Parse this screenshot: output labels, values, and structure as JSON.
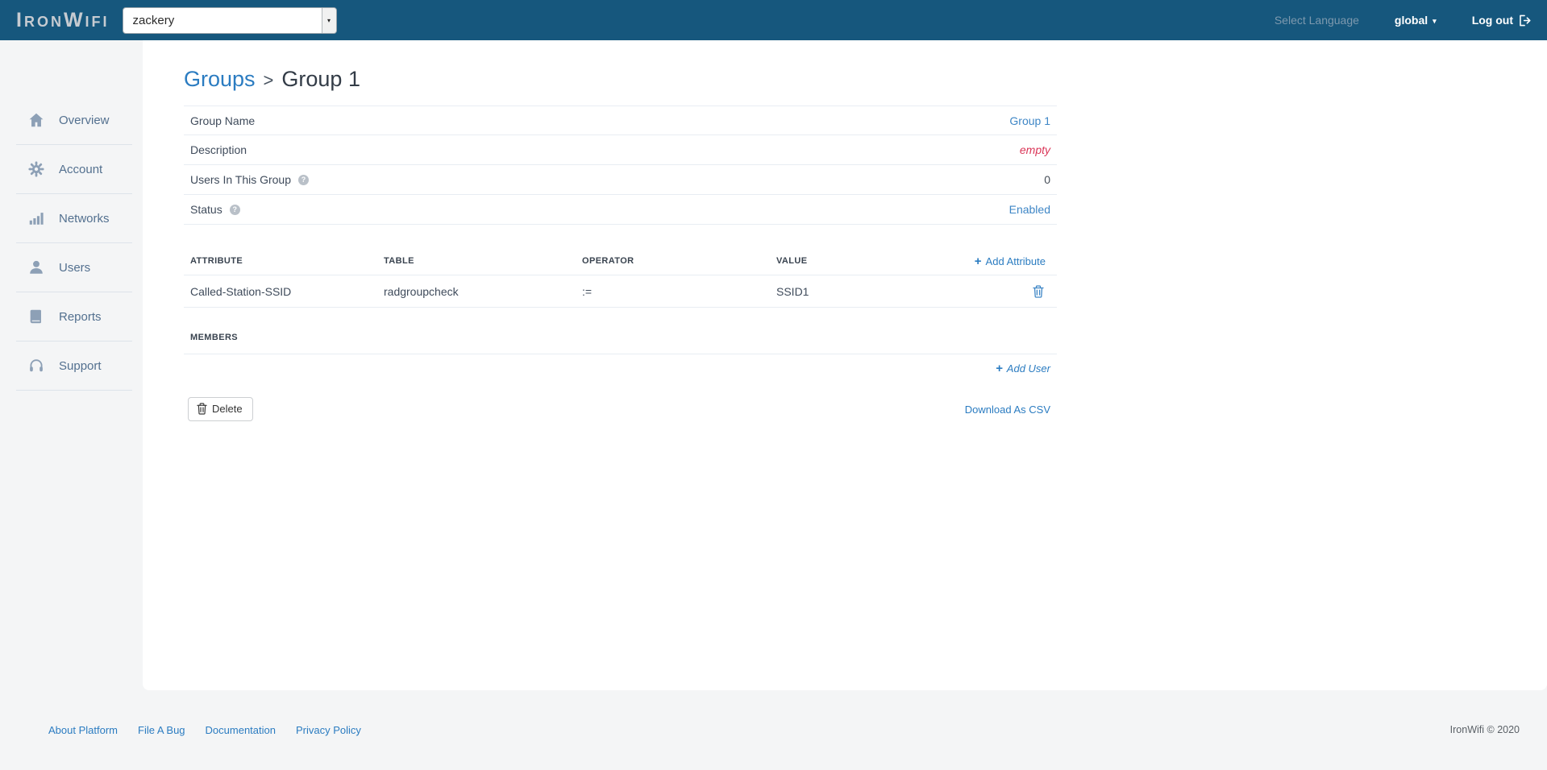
{
  "colors": {
    "navbar_bg": "#16577d",
    "accent_link": "#2b7cc1",
    "value_link": "#3e86c6",
    "empty_red": "#da3557",
    "page_bg": "#f4f5f6",
    "panel_bg": "#ffffff",
    "sidebar_icon": "#8da0b6"
  },
  "icons": {
    "plus": "+",
    "caret": "▾",
    "help": "?"
  },
  "navbar": {
    "logo": "IronWifi",
    "account_select": {
      "value": "zackery"
    },
    "select_language": "Select Language",
    "region": "global",
    "logout_label": "Log out"
  },
  "sidebar": {
    "items": [
      {
        "label": "Overview",
        "icon": "home-icon"
      },
      {
        "label": "Account",
        "icon": "gear-icon"
      },
      {
        "label": "Networks",
        "icon": "bar-chart-icon"
      },
      {
        "label": "Users",
        "icon": "user-icon"
      },
      {
        "label": "Reports",
        "icon": "book-icon"
      },
      {
        "label": "Support",
        "icon": "headset-icon"
      }
    ]
  },
  "breadcrumb": {
    "parent": "Groups",
    "separator": ">",
    "current": "Group 1"
  },
  "details": {
    "rows": [
      {
        "label": "Group Name",
        "value": "Group 1",
        "value_type": "link",
        "help": false
      },
      {
        "label": "Description",
        "value": "empty",
        "value_type": "empty",
        "help": false
      },
      {
        "label": "Users In This Group",
        "value": "0",
        "value_type": "plain",
        "help": true
      },
      {
        "label": "Status",
        "value": "Enabled",
        "value_type": "link",
        "help": true
      }
    ]
  },
  "attributes": {
    "headers": {
      "attribute": "ATTRIBUTE",
      "table": "TABLE",
      "operator": "OPERATOR",
      "value": "VALUE"
    },
    "add_label": "Add Attribute",
    "rows": [
      {
        "attribute": "Called-Station-SSID",
        "table": "radgroupcheck",
        "operator": ":=",
        "value": "SSID1"
      }
    ]
  },
  "members": {
    "title": "MEMBERS",
    "add_label": "Add User"
  },
  "actions": {
    "delete_label": "Delete",
    "download_label": "Download As CSV"
  },
  "footer": {
    "links": [
      {
        "label": "About Platform"
      },
      {
        "label": "File A Bug"
      },
      {
        "label": "Documentation"
      },
      {
        "label": "Privacy Policy"
      }
    ],
    "copyright": "IronWifi © 2020"
  }
}
